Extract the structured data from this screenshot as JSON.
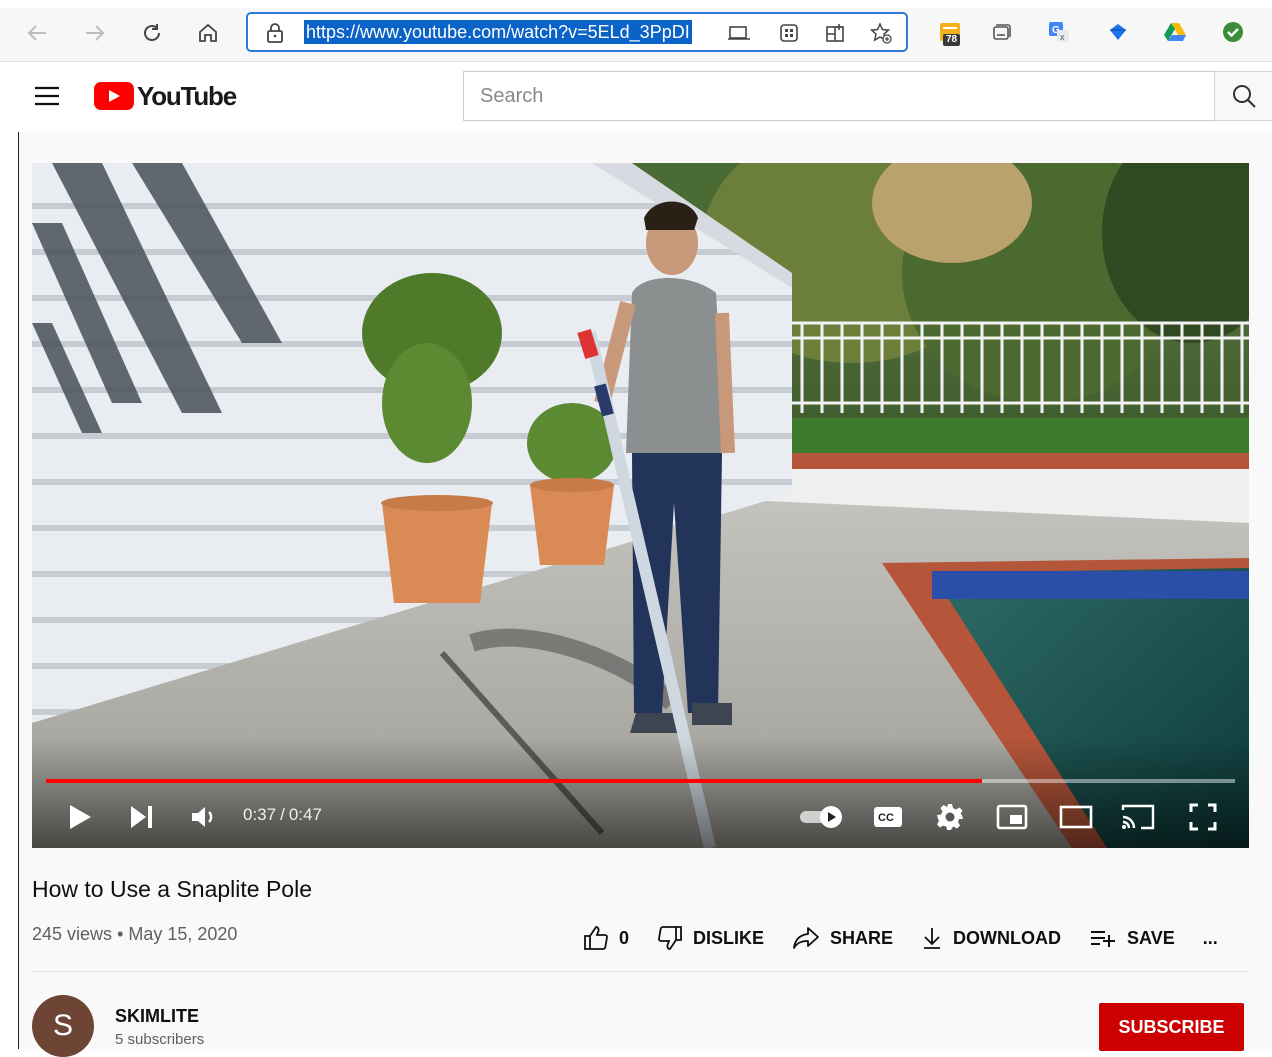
{
  "browser": {
    "url": "https://www.youtube.com/watch?v=5ELd_3PpDI",
    "extension_badge": "78",
    "colors": {
      "accent": "#2f7ad6",
      "url_highlight": "#0b63c7"
    },
    "icons": [
      "back-icon",
      "forward-icon",
      "refresh-icon",
      "home-icon",
      "lock-icon",
      "reader-view-icon",
      "app-available-icon",
      "split-screen-icon",
      "favorite-add-icon",
      "extension-icon",
      "collections-icon",
      "translate-icon",
      "bookmark-icon",
      "google-drive-icon",
      "check-icon"
    ]
  },
  "youtube": {
    "logo_text": "YouTube",
    "search": {
      "placeholder": "Search",
      "value": ""
    },
    "colors": {
      "brand": "#ff0000",
      "subscribe": "#cc0000"
    }
  },
  "player": {
    "current_time": "0:37",
    "duration": "0:47",
    "progress": 0.7872,
    "controls": [
      "play-icon",
      "next-icon",
      "volume-icon",
      "autoplay-toggle-icon",
      "captions-icon",
      "settings-icon",
      "miniplayer-icon",
      "theater-mode-icon",
      "cast-icon",
      "fullscreen-icon"
    ]
  },
  "video": {
    "title": "How to Use a Snaplite Pole",
    "views": "245 views",
    "date": "May 15, 2020",
    "actions": {
      "like_count": "0",
      "dislike": "DISLIKE",
      "share": "SHARE",
      "download": "DOWNLOAD",
      "save": "SAVE",
      "more": "..."
    }
  },
  "channel": {
    "avatar_letter": "S",
    "name": "SKIMLITE",
    "subscribers": "5 subscribers",
    "subscribe_label": "SUBSCRIBE"
  }
}
